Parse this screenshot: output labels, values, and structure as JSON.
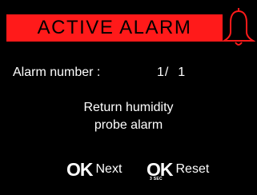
{
  "header": {
    "title": "ACTIVE ALARM",
    "icon": "bell-icon",
    "accent_color": "#ff1a1a"
  },
  "alarm": {
    "label": "Alarm number :",
    "value": "1/  1"
  },
  "message": {
    "line1": "Return humidity",
    "line2": "probe alarm"
  },
  "buttons": {
    "next": {
      "key": "OK",
      "label": "Next"
    },
    "reset": {
      "key": "OK",
      "sub": "3 SEC",
      "label": "Reset"
    }
  }
}
